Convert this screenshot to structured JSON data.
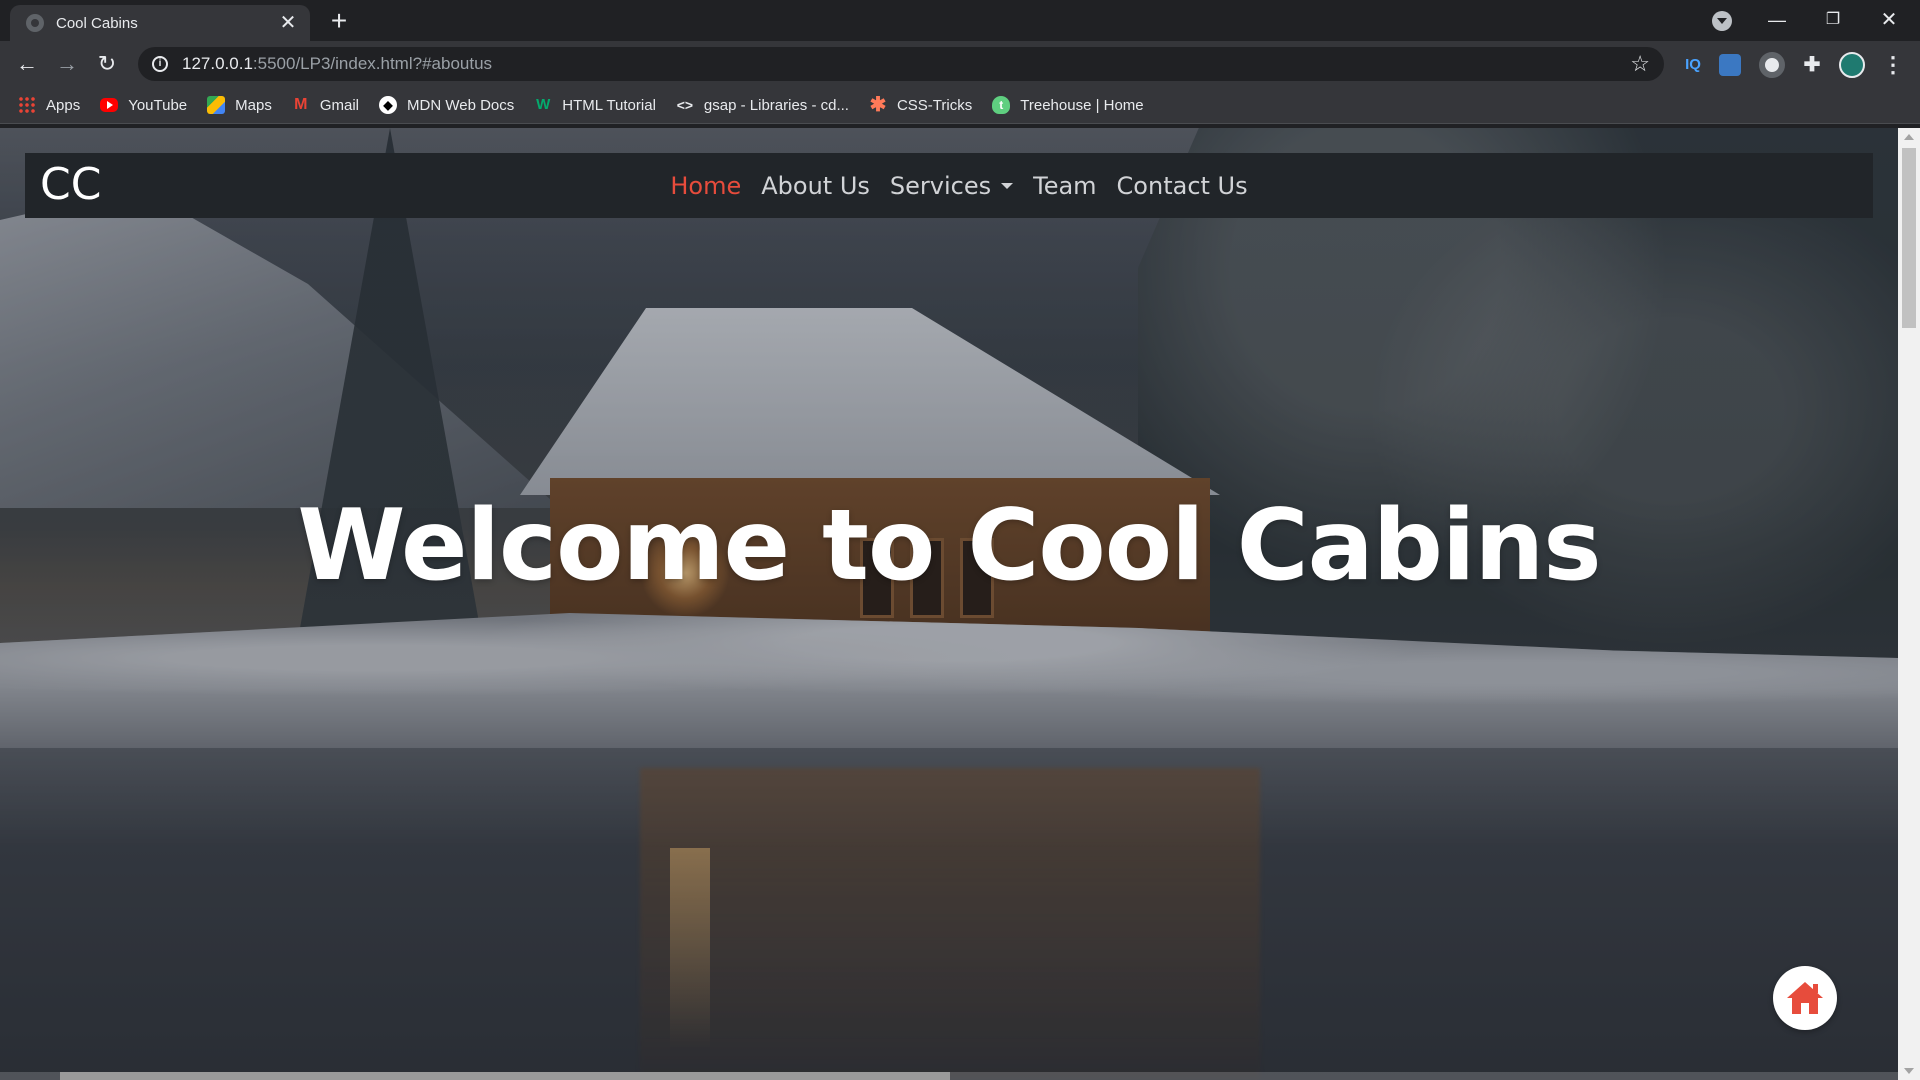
{
  "browser": {
    "tab_title": "Cool Cabins",
    "url_host": "127.0.0.1",
    "url_rest": ":5500/LP3/index.html?#aboutus",
    "extensions": [
      "IQ",
      "downloader-icon",
      "circle-icon",
      "puzzle-icon",
      "avatar-icon"
    ]
  },
  "bookmarks": [
    {
      "label": "Apps",
      "icon": "apps-grid-icon"
    },
    {
      "label": "YouTube",
      "icon": "youtube-icon"
    },
    {
      "label": "Maps",
      "icon": "maps-icon"
    },
    {
      "label": "Gmail",
      "icon": "gmail-icon"
    },
    {
      "label": "MDN Web Docs",
      "icon": "mdn-icon"
    },
    {
      "label": "HTML Tutorial",
      "icon": "w3schools-icon"
    },
    {
      "label": "gsap - Libraries - cd...",
      "icon": "code-icon"
    },
    {
      "label": "CSS-Tricks",
      "icon": "css-tricks-icon"
    },
    {
      "label": "Treehouse | Home",
      "icon": "treehouse-icon"
    }
  ],
  "site": {
    "brand": "CC",
    "nav": [
      {
        "label": "Home",
        "active": true
      },
      {
        "label": "About Us",
        "active": false
      },
      {
        "label": "Services",
        "active": false,
        "dropdown": true
      },
      {
        "label": "Team",
        "active": false
      },
      {
        "label": "Contact Us",
        "active": false
      }
    ],
    "hero_title": "Welcome to Cool Cabins",
    "accent_color": "#e74c3c",
    "nav_bg": "#212529"
  }
}
